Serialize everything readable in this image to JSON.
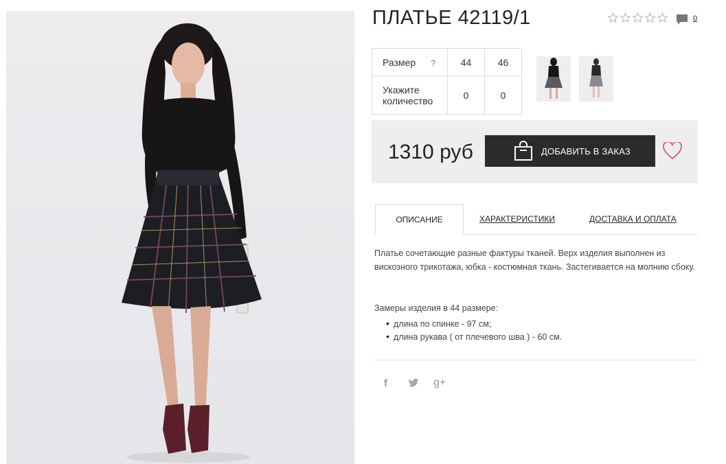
{
  "product": {
    "title": "ПЛАТЬЕ 42119/1",
    "rating_stars": 5,
    "rating_value": 0,
    "comments_count": "0"
  },
  "sizes": {
    "size_label": "Размер",
    "help": "?",
    "quantity_label": "Укажите количество",
    "columns": [
      {
        "size": "44",
        "quantity": "0"
      },
      {
        "size": "46",
        "quantity": "0"
      }
    ]
  },
  "purchase": {
    "price": "1310 руб",
    "add_button": "ДОБАВИТЬ В ЗАКАЗ"
  },
  "tabs": [
    {
      "label": "ОПИСАНИЕ",
      "active": true
    },
    {
      "label": "ХАРАКТЕРИСТИКИ",
      "active": false
    },
    {
      "label": "ДОСТАВКА И ОПЛАТА",
      "active": false
    }
  ],
  "description": {
    "text": "Платье сочетающие разные фактуры тканей. Верх изделия выполнен из вискозного трикотажа, юбка - костюмная ткань. Застегивается на молнию сбоку.",
    "measurements_title": "Замеры изделия в 44 размере:",
    "measurements": [
      "длина по спинке - 97 см;",
      "длина рукава ( от плечевого шва ) - 60 см."
    ]
  },
  "social": {
    "facebook": "f",
    "gplus": "g+"
  },
  "icons": [
    "star-icon",
    "comment-icon",
    "bag-icon",
    "heart-icon",
    "facebook-icon",
    "twitter-icon",
    "gplus-icon"
  ],
  "colors": {
    "button_bg": "#2b2b2b",
    "price_box_bg": "#eeeeee",
    "heart": "#d46a84"
  }
}
